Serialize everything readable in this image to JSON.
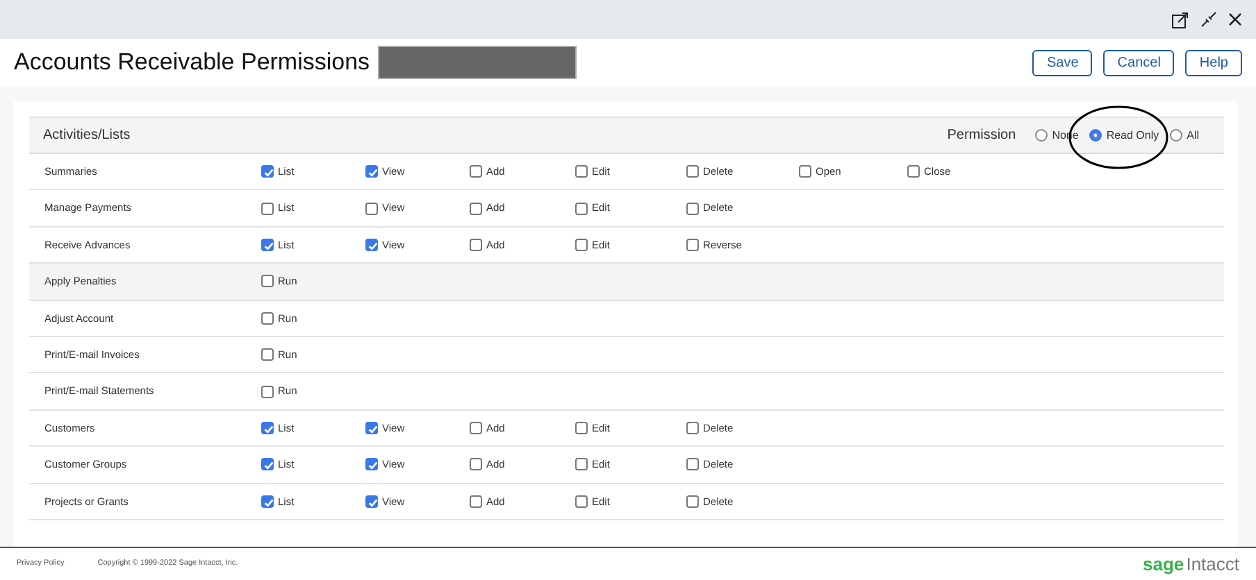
{
  "window": {
    "title": "Accounts Receivable Permissions"
  },
  "buttons": [
    "Save",
    "Cancel",
    "Help"
  ],
  "table": {
    "heading": "Activities/Lists",
    "permission_label": "Permission",
    "permission_options": [
      {
        "label": "None",
        "selected": false
      },
      {
        "label": "Read Only",
        "selected": true
      },
      {
        "label": "All",
        "selected": false
      }
    ],
    "rows": [
      {
        "label": "Summaries",
        "highlighted": false,
        "options": [
          {
            "label": "List",
            "checked": true
          },
          {
            "label": "View",
            "checked": true
          },
          {
            "label": "Add",
            "checked": false
          },
          {
            "label": "Edit",
            "checked": false
          },
          {
            "label": "Delete",
            "checked": false
          },
          {
            "label": "Open",
            "checked": false
          },
          {
            "label": "Close",
            "checked": false
          }
        ]
      },
      {
        "label": "Manage Payments",
        "highlighted": false,
        "options": [
          {
            "label": "List",
            "checked": false
          },
          {
            "label": "View",
            "checked": false
          },
          {
            "label": "Add",
            "checked": false
          },
          {
            "label": "Edit",
            "checked": false
          },
          {
            "label": "Delete",
            "checked": false
          }
        ]
      },
      {
        "label": "Receive Advances",
        "highlighted": false,
        "options": [
          {
            "label": "List",
            "checked": true
          },
          {
            "label": "View",
            "checked": true
          },
          {
            "label": "Add",
            "checked": false
          },
          {
            "label": "Edit",
            "checked": false
          },
          {
            "label": "Reverse",
            "checked": false
          }
        ]
      },
      {
        "label": "Apply Penalties",
        "highlighted": true,
        "options": [
          {
            "label": "Run",
            "checked": false
          }
        ]
      },
      {
        "label": "Adjust Account",
        "highlighted": false,
        "options": [
          {
            "label": "Run",
            "checked": false
          }
        ]
      },
      {
        "label": "Print/E-mail Invoices",
        "highlighted": false,
        "options": [
          {
            "label": "Run",
            "checked": false
          }
        ]
      },
      {
        "label": "Print/E-mail Statements",
        "highlighted": false,
        "options": [
          {
            "label": "Run",
            "checked": false
          }
        ]
      },
      {
        "label": "Customers",
        "highlighted": false,
        "options": [
          {
            "label": "List",
            "checked": true
          },
          {
            "label": "View",
            "checked": true
          },
          {
            "label": "Add",
            "checked": false
          },
          {
            "label": "Edit",
            "checked": false
          },
          {
            "label": "Delete",
            "checked": false
          }
        ]
      },
      {
        "label": "Customer Groups",
        "highlighted": false,
        "options": [
          {
            "label": "List",
            "checked": true
          },
          {
            "label": "View",
            "checked": true
          },
          {
            "label": "Add",
            "checked": false
          },
          {
            "label": "Edit",
            "checked": false
          },
          {
            "label": "Delete",
            "checked": false
          }
        ]
      },
      {
        "label": "Projects or Grants",
        "highlighted": false,
        "options": [
          {
            "label": "List",
            "checked": true
          },
          {
            "label": "View",
            "checked": true
          },
          {
            "label": "Add",
            "checked": false
          },
          {
            "label": "Edit",
            "checked": false
          },
          {
            "label": "Delete",
            "checked": false
          }
        ]
      }
    ]
  },
  "footer": {
    "links": [
      "Privacy Policy"
    ],
    "copyright": "Copyright © 1999-2022 Sage Intacct, Inc.",
    "logo": {
      "part_1": "sage",
      "part_2": "Intacct"
    }
  }
}
